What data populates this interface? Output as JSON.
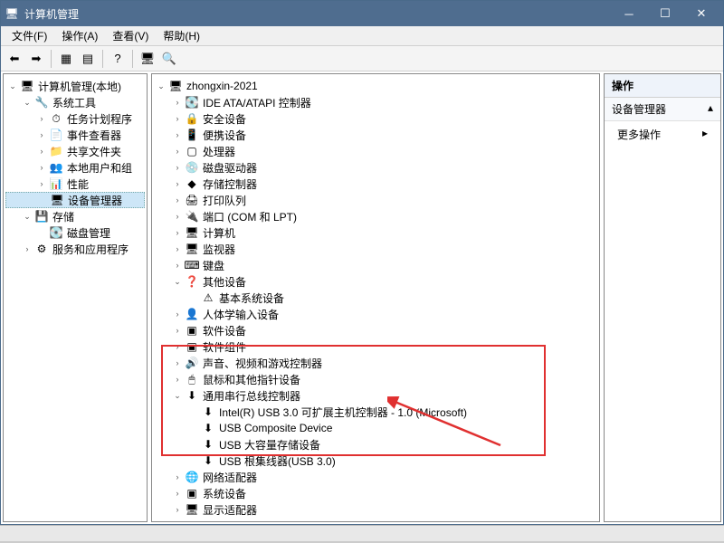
{
  "titlebar": {
    "title": "计算机管理"
  },
  "menu": {
    "file": "文件(F)",
    "action": "操作(A)",
    "view": "查看(V)",
    "help": "帮助(H)"
  },
  "left_tree": [
    {
      "depth": 0,
      "tw": "v",
      "icon": "🖥",
      "label": "计算机管理(本地)"
    },
    {
      "depth": 1,
      "tw": "v",
      "icon": "🔧",
      "label": "系统工具",
      "color": "#cc9900"
    },
    {
      "depth": 2,
      "tw": ">",
      "icon": "⏱",
      "label": "任务计划程序"
    },
    {
      "depth": 2,
      "tw": ">",
      "icon": "📄",
      "label": "事件查看器"
    },
    {
      "depth": 2,
      "tw": ">",
      "icon": "📁",
      "label": "共享文件夹"
    },
    {
      "depth": 2,
      "tw": ">",
      "icon": "👥",
      "label": "本地用户和组"
    },
    {
      "depth": 2,
      "tw": ">",
      "icon": "📊",
      "label": "性能"
    },
    {
      "depth": 2,
      "tw": "",
      "icon": "🖥",
      "label": "设备管理器",
      "selected": true
    },
    {
      "depth": 1,
      "tw": "v",
      "icon": "💾",
      "label": "存储"
    },
    {
      "depth": 2,
      "tw": "",
      "icon": "💽",
      "label": "磁盘管理"
    },
    {
      "depth": 1,
      "tw": ">",
      "icon": "⚙",
      "label": "服务和应用程序"
    }
  ],
  "device_tree": [
    {
      "depth": 0,
      "tw": "v",
      "icon": "🖥",
      "label": "zhongxin-2021"
    },
    {
      "depth": 1,
      "tw": ">",
      "icon": "💽",
      "label": "IDE ATA/ATAPI 控制器"
    },
    {
      "depth": 1,
      "tw": ">",
      "icon": "🔒",
      "label": "安全设备"
    },
    {
      "depth": 1,
      "tw": ">",
      "icon": "📱",
      "label": "便携设备"
    },
    {
      "depth": 1,
      "tw": ">",
      "icon": "▢",
      "label": "处理器"
    },
    {
      "depth": 1,
      "tw": ">",
      "icon": "💿",
      "label": "磁盘驱动器"
    },
    {
      "depth": 1,
      "tw": ">",
      "icon": "◆",
      "label": "存储控制器"
    },
    {
      "depth": 1,
      "tw": ">",
      "icon": "🖨",
      "label": "打印队列"
    },
    {
      "depth": 1,
      "tw": ">",
      "icon": "🔌",
      "label": "端口 (COM 和 LPT)"
    },
    {
      "depth": 1,
      "tw": ">",
      "icon": "🖥",
      "label": "计算机"
    },
    {
      "depth": 1,
      "tw": ">",
      "icon": "🖥",
      "label": "监视器"
    },
    {
      "depth": 1,
      "tw": ">",
      "icon": "⌨",
      "label": "键盘"
    },
    {
      "depth": 1,
      "tw": "v",
      "icon": "❓",
      "label": "其他设备"
    },
    {
      "depth": 2,
      "tw": "",
      "icon": "⚠",
      "label": "基本系统设备"
    },
    {
      "depth": 1,
      "tw": ">",
      "icon": "👤",
      "label": "人体学输入设备"
    },
    {
      "depth": 1,
      "tw": ">",
      "icon": "▣",
      "label": "软件设备"
    },
    {
      "depth": 1,
      "tw": ">",
      "icon": "▣",
      "label": "软件组件"
    },
    {
      "depth": 1,
      "tw": ">",
      "icon": "🔊",
      "label": "声音、视频和游戏控制器"
    },
    {
      "depth": 1,
      "tw": ">",
      "icon": "🖱",
      "label": "鼠标和其他指针设备"
    },
    {
      "depth": 1,
      "tw": "v",
      "icon": "⬇",
      "label": "通用串行总线控制器"
    },
    {
      "depth": 2,
      "tw": "",
      "icon": "⬇",
      "label": "Intel(R) USB 3.0 可扩展主机控制器 - 1.0 (Microsoft)"
    },
    {
      "depth": 2,
      "tw": "",
      "icon": "⬇",
      "label": "USB Composite Device"
    },
    {
      "depth": 2,
      "tw": "",
      "icon": "⬇",
      "label": "USB 大容量存储设备"
    },
    {
      "depth": 2,
      "tw": "",
      "icon": "⬇",
      "label": "USB 根集线器(USB 3.0)"
    },
    {
      "depth": 1,
      "tw": ">",
      "icon": "🌐",
      "label": "网络适配器"
    },
    {
      "depth": 1,
      "tw": ">",
      "icon": "▣",
      "label": "系统设备"
    },
    {
      "depth": 1,
      "tw": ">",
      "icon": "🖥",
      "label": "显示适配器"
    }
  ],
  "right": {
    "head": "操作",
    "sub": "设备管理器",
    "item": "更多操作"
  }
}
